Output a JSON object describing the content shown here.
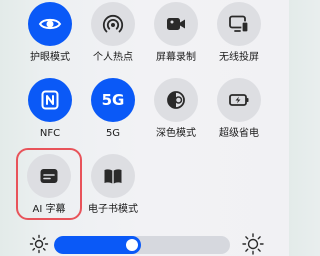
{
  "colors": {
    "accent": "#0a59f7",
    "tile_off": "#dddee2",
    "highlight": "#e8535a"
  },
  "tiles": [
    {
      "label": "护眼模式",
      "icon": "eye-icon",
      "active": true
    },
    {
      "label": "个人热点",
      "icon": "hotspot-icon",
      "active": false
    },
    {
      "label": "屏幕录制",
      "icon": "screen-record-icon",
      "active": false
    },
    {
      "label": "无线投屏",
      "icon": "wireless-projection-icon",
      "active": false
    },
    {
      "label": "NFC",
      "icon": "nfc-icon",
      "active": true
    },
    {
      "label": "5G",
      "icon_text": "5G",
      "icon": "5g-icon",
      "active": true
    },
    {
      "label": "深色模式",
      "icon": "dark-mode-icon",
      "active": false
    },
    {
      "label": "超级省电",
      "icon": "battery-saver-icon",
      "active": false
    },
    {
      "label": "AI 字幕",
      "icon": "ai-subtitle-icon",
      "active": false,
      "highlighted": true
    },
    {
      "label": "电子书模式",
      "icon": "ebook-icon",
      "active": false
    }
  ],
  "brightness": {
    "level": 0.45,
    "icons": [
      "brightness-low-icon",
      "brightness-high-icon"
    ]
  }
}
